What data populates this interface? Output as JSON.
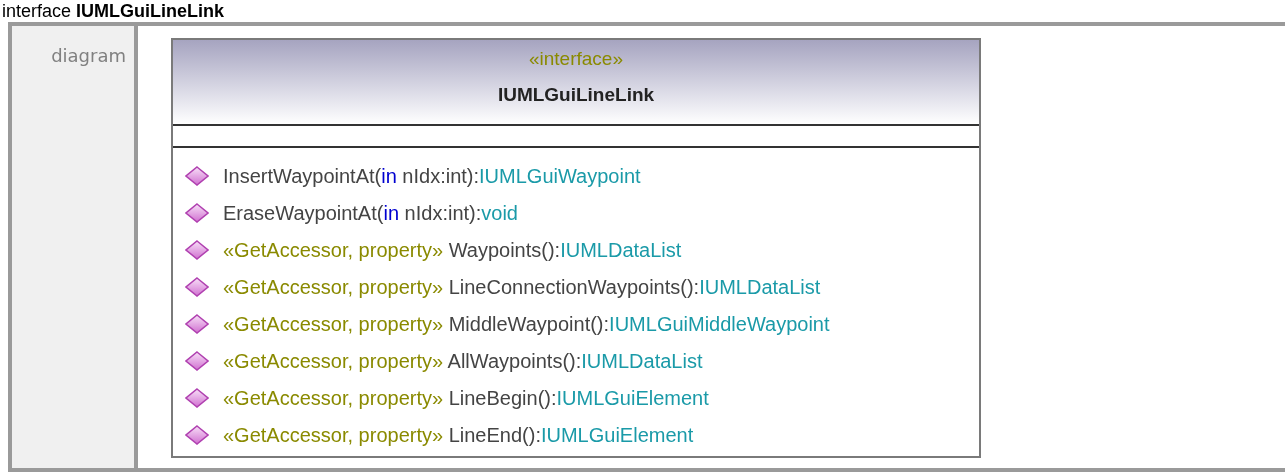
{
  "heading": {
    "kind_word": "interface",
    "name": "IUMLGuiLineLink"
  },
  "row_label": "diagram",
  "class_box": {
    "stereotype": "«interface»",
    "name": "IUMLGuiLineLink",
    "operations": [
      {
        "segments": [
          {
            "kind": "plain",
            "text": "InsertWaypointAt("
          },
          {
            "kind": "keyword",
            "text": "in"
          },
          {
            "kind": "plain",
            "text": " nIdx:int):"
          },
          {
            "kind": "type",
            "text": "IUMLGuiWaypoint"
          }
        ]
      },
      {
        "segments": [
          {
            "kind": "plain",
            "text": "EraseWaypointAt("
          },
          {
            "kind": "keyword",
            "text": "in"
          },
          {
            "kind": "plain",
            "text": " nIdx:int):"
          },
          {
            "kind": "type",
            "text": "void"
          }
        ]
      },
      {
        "segments": [
          {
            "kind": "stereotype",
            "text": "«GetAccessor, property»"
          },
          {
            "kind": "plain",
            "text": " Waypoints():"
          },
          {
            "kind": "type",
            "text": "IUMLDataList"
          }
        ]
      },
      {
        "segments": [
          {
            "kind": "stereotype",
            "text": "«GetAccessor, property»"
          },
          {
            "kind": "plain",
            "text": " LineConnectionWaypoints():"
          },
          {
            "kind": "type",
            "text": "IUMLDataList"
          }
        ]
      },
      {
        "segments": [
          {
            "kind": "stereotype",
            "text": "«GetAccessor, property»"
          },
          {
            "kind": "plain",
            "text": " MiddleWaypoint():"
          },
          {
            "kind": "type",
            "text": "IUMLGuiMiddleWaypoint"
          }
        ]
      },
      {
        "segments": [
          {
            "kind": "stereotype",
            "text": "«GetAccessor, property»"
          },
          {
            "kind": "plain",
            "text": " AllWaypoints():"
          },
          {
            "kind": "type",
            "text": "IUMLDataList"
          }
        ]
      },
      {
        "segments": [
          {
            "kind": "stereotype",
            "text": "«GetAccessor, property»"
          },
          {
            "kind": "plain",
            "text": " LineBegin():"
          },
          {
            "kind": "type",
            "text": "IUMLGuiElement"
          }
        ]
      },
      {
        "segments": [
          {
            "kind": "stereotype",
            "text": "«GetAccessor, property»"
          },
          {
            "kind": "plain",
            "text": " LineEnd():"
          },
          {
            "kind": "type",
            "text": "IUMLGuiElement"
          }
        ]
      }
    ]
  }
}
